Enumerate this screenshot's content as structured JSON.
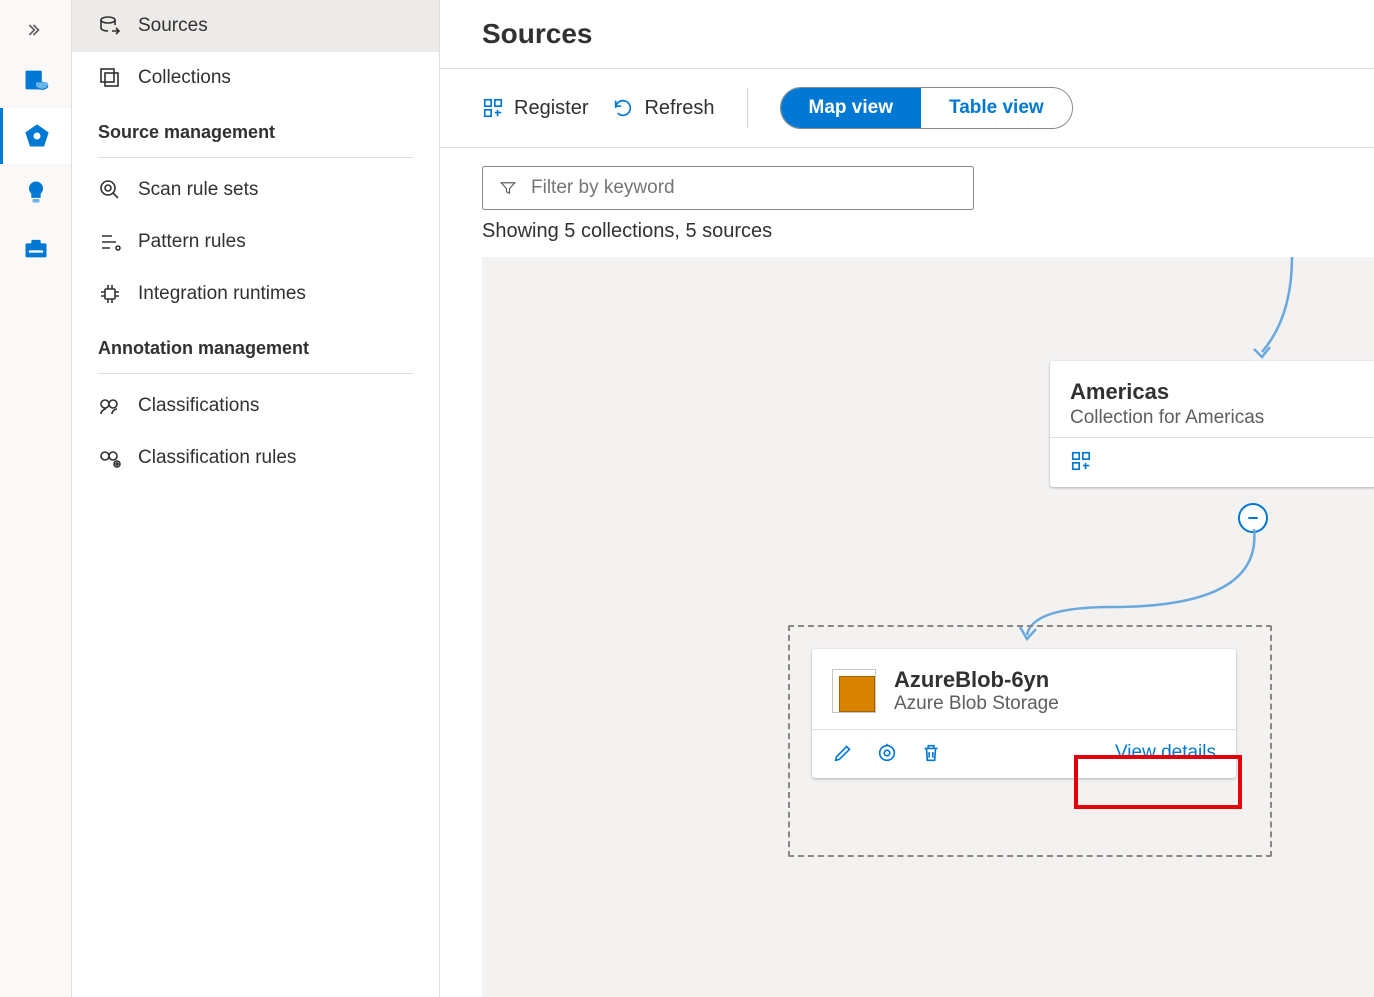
{
  "rail": {
    "items": [
      "catalog-icon",
      "data-map-icon",
      "insights-icon",
      "toolbox-icon"
    ]
  },
  "sidebar": {
    "primary": [
      {
        "label": "Sources"
      },
      {
        "label": "Collections"
      }
    ],
    "section1_header": "Source management",
    "section1": [
      {
        "label": "Scan rule sets"
      },
      {
        "label": "Pattern rules"
      },
      {
        "label": "Integration runtimes"
      }
    ],
    "section2_header": "Annotation management",
    "section2": [
      {
        "label": "Classifications"
      },
      {
        "label": "Classification rules"
      }
    ]
  },
  "page": {
    "title": "Sources"
  },
  "toolbar": {
    "register": "Register",
    "refresh": "Refresh",
    "view_map": "Map view",
    "view_table": "Table view"
  },
  "filter": {
    "placeholder": "Filter by keyword"
  },
  "status": {
    "text": "Showing 5 collections, 5 sources"
  },
  "collection": {
    "title": "Americas",
    "subtitle": "Collection for Americas"
  },
  "source": {
    "title": "AzureBlob-6yn",
    "subtitle": "Azure Blob Storage",
    "view_details": "View details"
  }
}
